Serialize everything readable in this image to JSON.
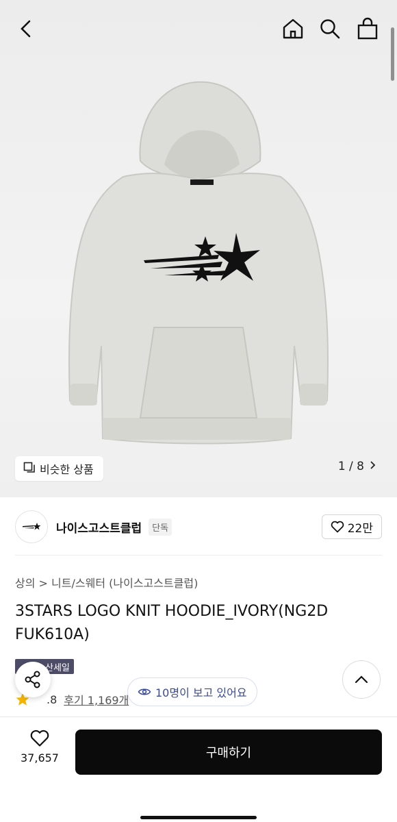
{
  "header": {
    "back_icon": "chevron-left-icon",
    "home_icon": "home-icon",
    "search_icon": "search-icon",
    "cart_icon": "shopping-bag-icon"
  },
  "gallery": {
    "similar_label": "비슷한 상품",
    "pager": "1 / 8"
  },
  "brand": {
    "name": "나이스고스트클럽",
    "tag": "단독",
    "likes": "22만"
  },
  "breadcrumb": {
    "category": "상의",
    "separator": ">",
    "subcategory": "니트/스웨터",
    "brand": "(나이스고스트클럽)"
  },
  "product": {
    "title": "3STARS LOGO KNIT HOODIE_IVORY(NG2D FUK610A)",
    "badge": "산세일",
    "rating": ".8",
    "reviews": "후기 1,169개",
    "viewers": "10명이 보고 있어요"
  },
  "actions": {
    "wish_count": "37,657",
    "buy_label": "구매하기"
  },
  "colors": {
    "buy_button": "#0b0b0b",
    "viewer_text": "#3a4a9a",
    "star": "#f5b400",
    "badge_bg": "#4c4c66"
  }
}
